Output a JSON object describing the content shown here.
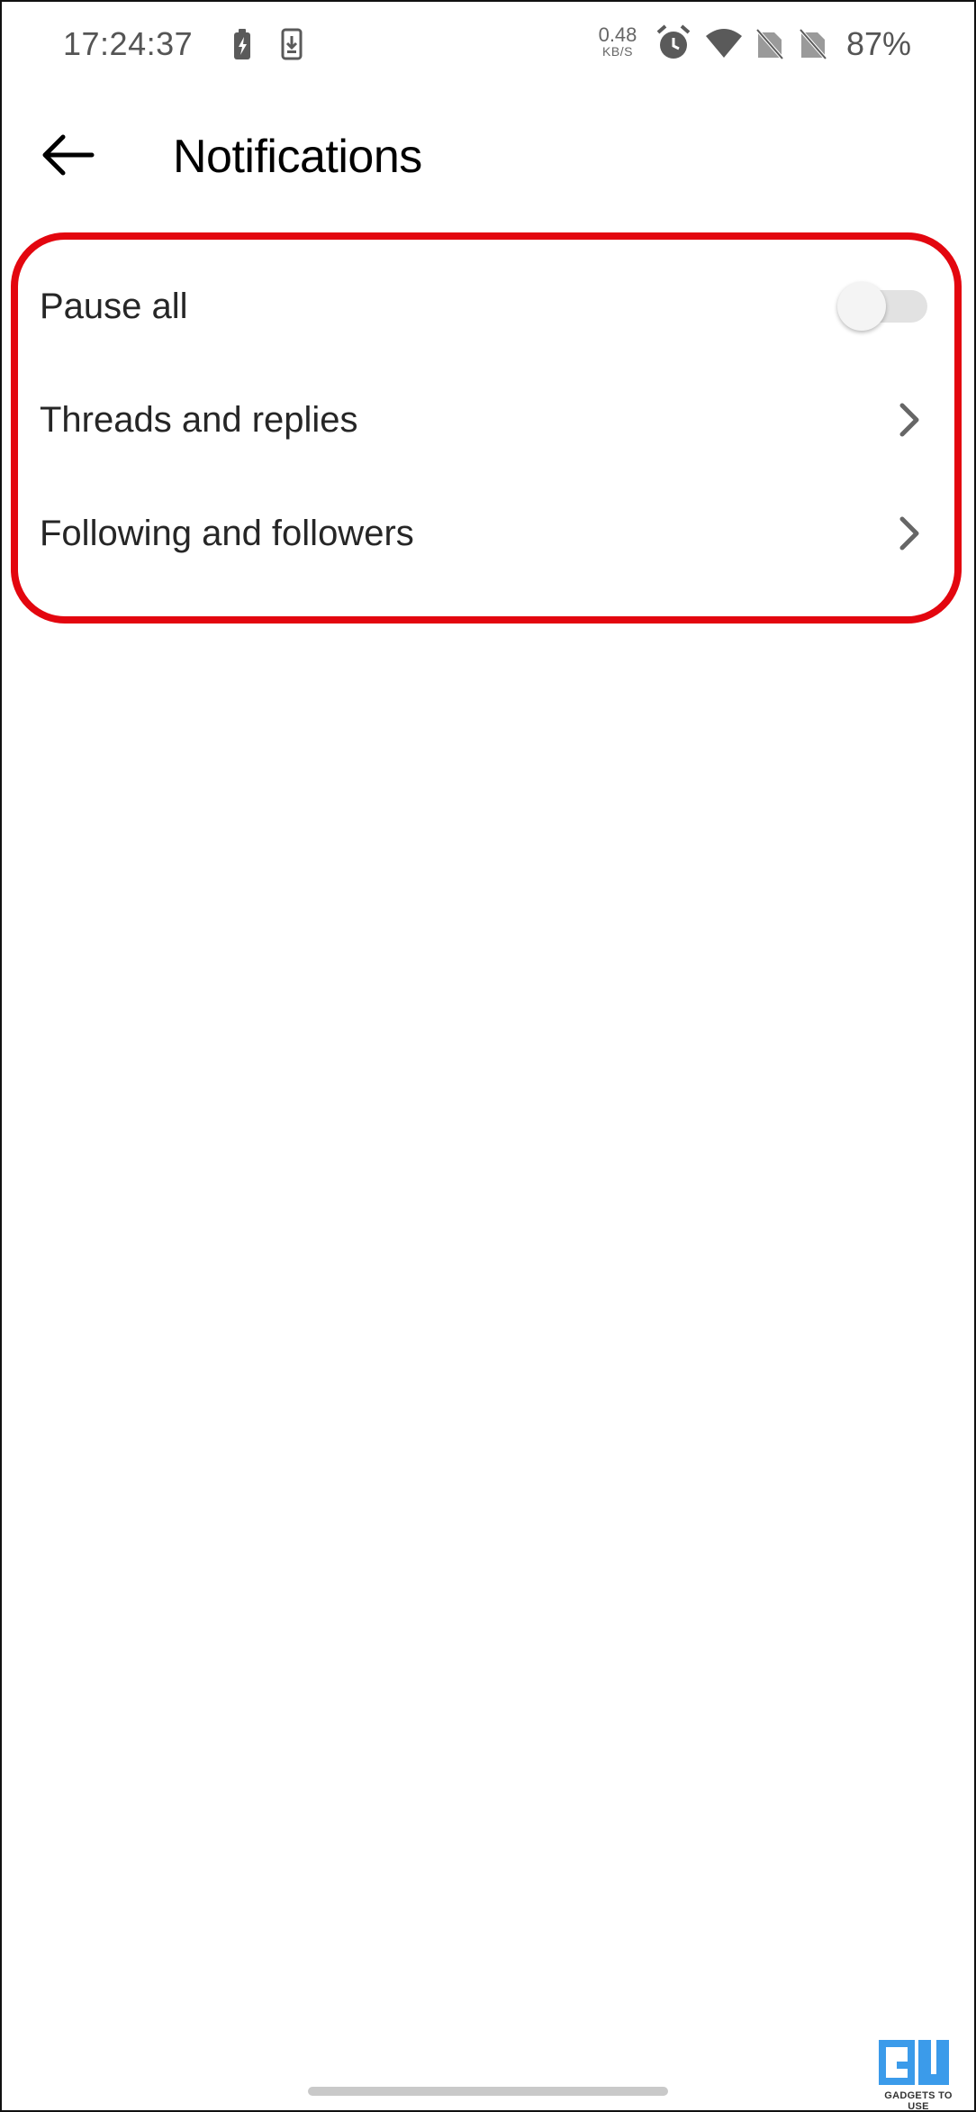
{
  "status_bar": {
    "time": "17:24:37",
    "net_speed_value": "0.48",
    "net_speed_unit": "KB/S",
    "battery": "87%",
    "icons": [
      "battery-saver-icon",
      "download-icon",
      "alarm-icon",
      "wifi-icon",
      "no-sim-icon",
      "no-sim-icon"
    ]
  },
  "header": {
    "title": "Notifications",
    "back_icon": "arrow-left-icon"
  },
  "settings": {
    "items": [
      {
        "label": "Pause all",
        "control": "toggle",
        "toggle_on": false
      },
      {
        "label": "Threads and replies",
        "control": "chevron-right-icon"
      },
      {
        "label": "Following and followers",
        "control": "chevron-right-icon"
      }
    ]
  },
  "watermark": {
    "text": "GADGETS TO USE"
  },
  "colors": {
    "highlight": "#e3060f",
    "toggle_track": "#e2e2e2",
    "toggle_thumb": "#f4f4f4",
    "watermark_blue": "#3b9bea"
  }
}
